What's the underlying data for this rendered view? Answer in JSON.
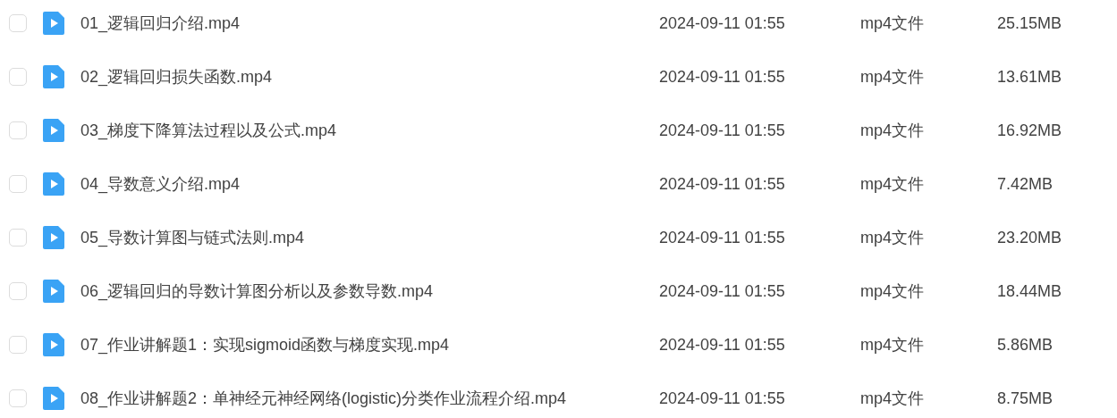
{
  "files": [
    {
      "name": "01_逻辑回归介绍.mp4",
      "modified": "2024-09-11 01:55",
      "type": "mp4文件",
      "size": "25.15MB",
      "checked": false
    },
    {
      "name": "02_逻辑回归损失函数.mp4",
      "modified": "2024-09-11 01:55",
      "type": "mp4文件",
      "size": "13.61MB",
      "checked": false
    },
    {
      "name": "03_梯度下降算法过程以及公式.mp4",
      "modified": "2024-09-11 01:55",
      "type": "mp4文件",
      "size": "16.92MB",
      "checked": false
    },
    {
      "name": "04_导数意义介绍.mp4",
      "modified": "2024-09-11 01:55",
      "type": "mp4文件",
      "size": "7.42MB",
      "checked": false
    },
    {
      "name": "05_导数计算图与链式法则.mp4",
      "modified": "2024-09-11 01:55",
      "type": "mp4文件",
      "size": "23.20MB",
      "checked": false
    },
    {
      "name": "06_逻辑回归的导数计算图分析以及参数导数.mp4",
      "modified": "2024-09-11 01:55",
      "type": "mp4文件",
      "size": "18.44MB",
      "checked": false
    },
    {
      "name": "07_作业讲解题1：实现sigmoid函数与梯度实现.mp4",
      "modified": "2024-09-11 01:55",
      "type": "mp4文件",
      "size": "5.86MB",
      "checked": false
    },
    {
      "name": "08_作业讲解题2：单神经元神经网络(logistic)分类作业流程介绍.mp4",
      "modified": "2024-09-11 01:55",
      "type": "mp4文件",
      "size": "8.75MB",
      "checked": false
    }
  ]
}
